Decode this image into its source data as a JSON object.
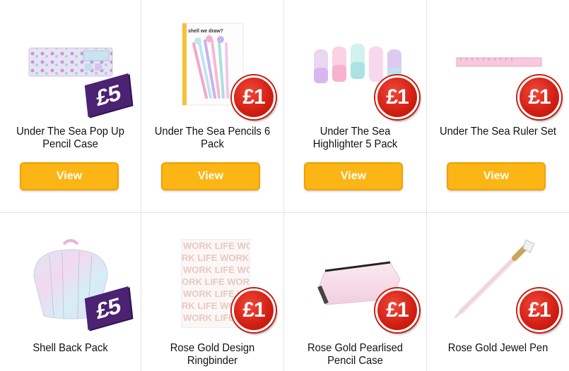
{
  "products": [
    {
      "name": "Under The Sea Pop Up Pencil Case",
      "price": "£5",
      "badge": "purple",
      "cta": "View"
    },
    {
      "name": "Under The Sea Pencils 6 Pack",
      "price": "£1",
      "badge": "red",
      "cta": "View"
    },
    {
      "name": "Under The Sea Highlighter 5 Pack",
      "price": "£1",
      "badge": "red",
      "cta": "View"
    },
    {
      "name": "Under The Sea Ruler Set",
      "price": "£1",
      "badge": "red",
      "cta": "View"
    },
    {
      "name": "Shell Back Pack",
      "price": "£5",
      "badge": "purple"
    },
    {
      "name": "Rose Gold Design Ringbinder",
      "price": "£1",
      "badge": "red"
    },
    {
      "name": "Rose Gold Pearlised Pencil Case",
      "price": "£1",
      "badge": "red"
    },
    {
      "name": "Rose Gold Jewel Pen",
      "price": "£1",
      "badge": "red"
    }
  ],
  "pencils_card_text": "shell we draw?",
  "ringbinder_pattern": [
    "WORK LIFE WO",
    "RK LIFE WORK",
    "WORK LIFE WO",
    "ORK LIFE WOR",
    "WORK LIFE WO",
    "RK LIFE WORK",
    "WORK LIFE WO"
  ],
  "colors": {
    "button": "#fbb514",
    "badge_red": "#d21e12",
    "badge_purple": "#4b2372"
  }
}
